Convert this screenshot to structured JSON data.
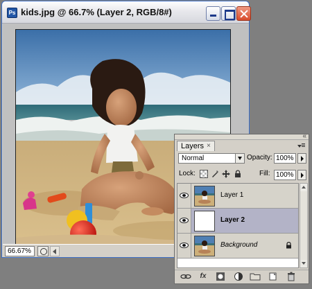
{
  "document": {
    "title": "kids.jpg @ 66.7% (Layer 2, RGB/8#)",
    "app_icon_text": "Ps",
    "zoom_value": "66.67%"
  },
  "layers_panel": {
    "tab_label": "Layers",
    "tab_close": "×",
    "panel_close": "«",
    "blend_mode": "Normal",
    "opacity_label": "Opacity:",
    "opacity_value": "100%",
    "lock_label": "Lock:",
    "fill_label": "Fill:",
    "fill_value": "100%",
    "layers": [
      {
        "name": "Layer 1",
        "visible": true,
        "selected": false,
        "locked": false
      },
      {
        "name": "Layer 2",
        "visible": true,
        "selected": true,
        "locked": false
      },
      {
        "name": "Background",
        "visible": true,
        "selected": false,
        "locked": true
      }
    ],
    "footer_icons": [
      "link-icon",
      "fx-icon",
      "mask-icon",
      "adjustment-icon",
      "folder-icon",
      "new-layer-icon",
      "trash-icon"
    ],
    "fx_text": "fx"
  }
}
